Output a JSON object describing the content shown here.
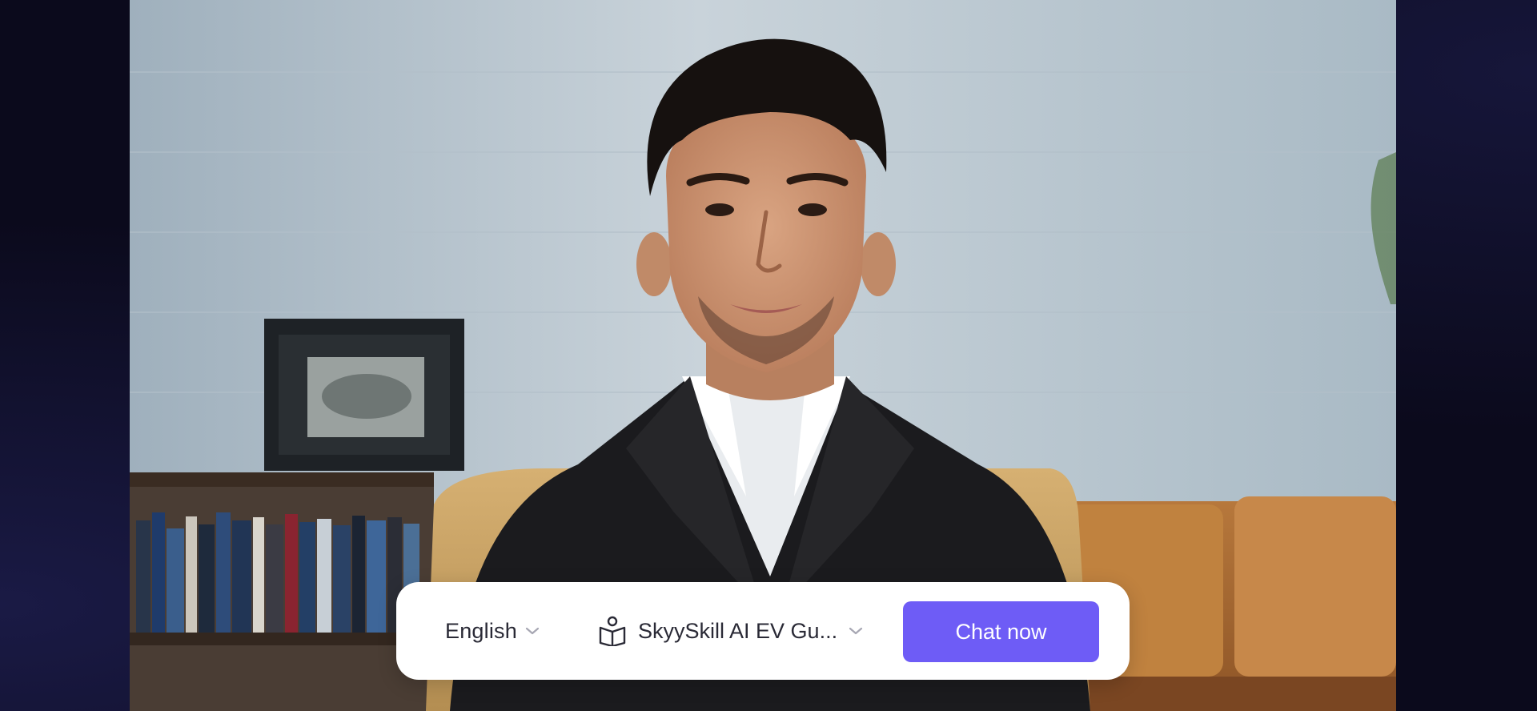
{
  "stage": {
    "video_alt": "AI avatar presenter video"
  },
  "controls": {
    "language": {
      "selected": "English",
      "icon": "chevron-down-icon"
    },
    "knowledge_base": {
      "selected": "SkyySkill AI EV Gu...",
      "icon": "book-reader-icon",
      "chevron_icon": "chevron-down-icon"
    },
    "chat_button": {
      "label": "Chat now"
    }
  },
  "colors": {
    "page_background": "#0b0a1c",
    "panel_background": "#ffffff",
    "primary_button": "#6e5cf6",
    "text": "#2a2a36",
    "chevron": "#a7a7b3"
  }
}
